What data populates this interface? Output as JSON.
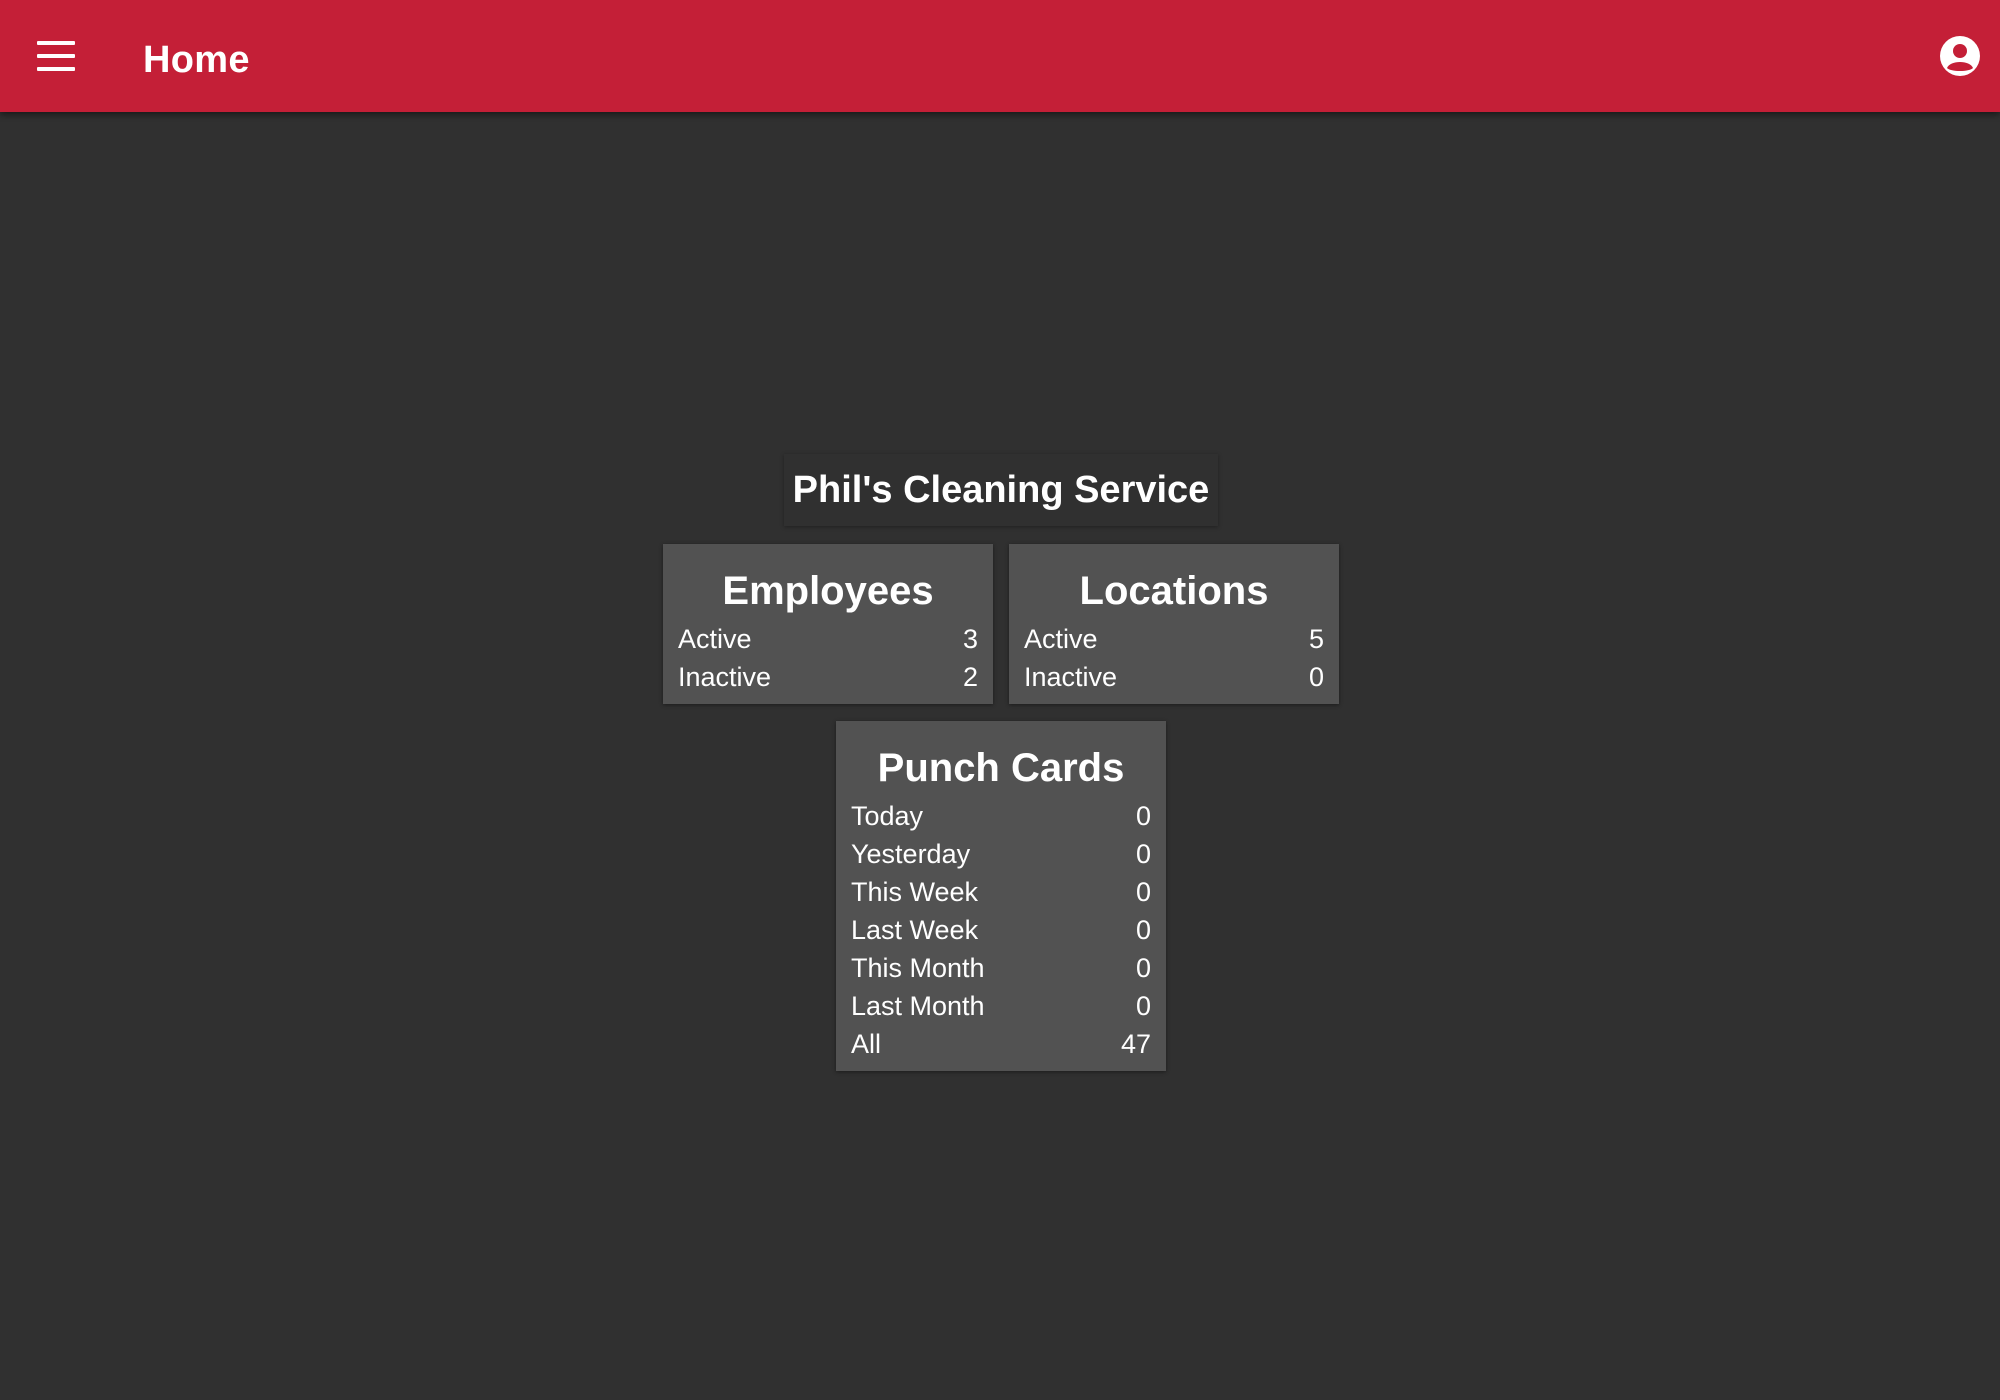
{
  "appbar": {
    "title": "Home",
    "menu_icon": "hamburger-menu-icon",
    "account_icon": "account-circle-icon",
    "color": "#c41f37"
  },
  "company": {
    "name": "Phil's Cleaning Service"
  },
  "employees": {
    "title": "Employees",
    "rows": [
      {
        "label": "Active",
        "value": "3"
      },
      {
        "label": "Inactive",
        "value": "2"
      }
    ]
  },
  "locations": {
    "title": "Locations",
    "rows": [
      {
        "label": "Active",
        "value": "5"
      },
      {
        "label": "Inactive",
        "value": "0"
      }
    ]
  },
  "punch_cards": {
    "title": "Punch Cards",
    "rows": [
      {
        "label": "Today",
        "value": "0"
      },
      {
        "label": "Yesterday",
        "value": "0"
      },
      {
        "label": "This Week",
        "value": "0"
      },
      {
        "label": "Last Week",
        "value": "0"
      },
      {
        "label": "This Month",
        "value": "0"
      },
      {
        "label": "Last Month",
        "value": "0"
      },
      {
        "label": "All",
        "value": "47"
      }
    ]
  },
  "colors": {
    "background": "#303030",
    "card": "#525252",
    "text": "#ffffff"
  }
}
